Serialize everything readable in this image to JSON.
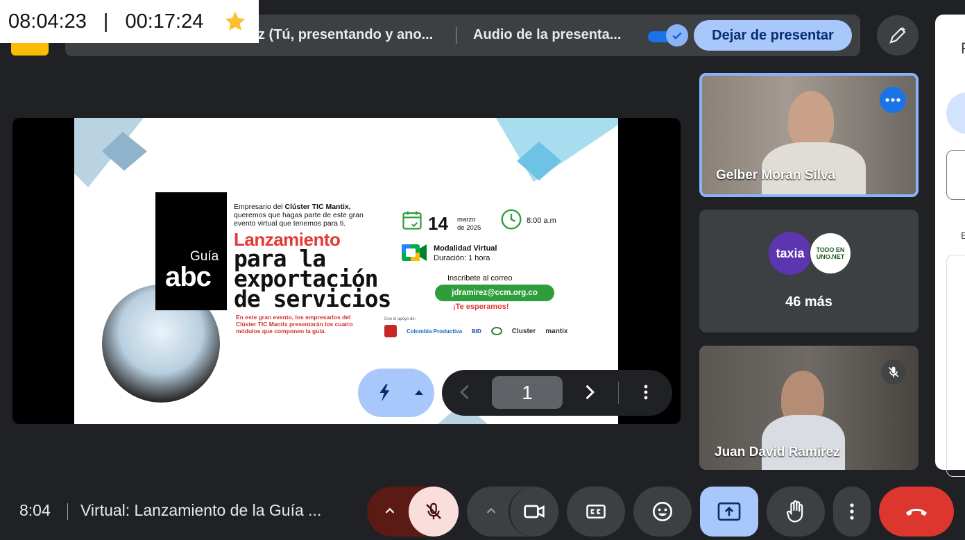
{
  "timer": {
    "clock": "08:04:23",
    "separator": "|",
    "elapsed": "00:17:24"
  },
  "present_bar": {
    "presenter_text": "z (Tú, presentando y ano...",
    "audio_label": "Audio de la presenta...",
    "stop_label": "Dejar de presentar"
  },
  "side_panel": {
    "letter": "F",
    "small": "E"
  },
  "slide": {
    "guia": "Guía",
    "abc": "abc",
    "intro_prefix": "Empresario del ",
    "intro_bold": "Clúster TIC Mantix,",
    "intro_rest": " queremos que hagas parte de este gran evento virtual que tenemos para ti.",
    "lanzamiento": "Lanzamiento",
    "para_la": "para la",
    "exportacion": "exportación",
    "de_servicios": "de servicios",
    "description": "En este gran evento, los empresarios del Clúster TIC Mantix presentarán los cuatro módulos que componen la guía.",
    "apoyo": "Con el apoyo de:",
    "day": "14",
    "month": "marzo",
    "year": "de 2025",
    "time": "8:00 a.m",
    "modalidad": "Modalidad Virtual",
    "duracion": "Duración: 1 hora",
    "inscribete": "Inscribete al correo",
    "email": "jdramirez@ccm.org.co",
    "esperamos": "¡Te esperamos!",
    "logos": [
      "Colombia Productiva",
      "BID",
      "Cluster",
      "mantix"
    ]
  },
  "slide_nav": {
    "page": "1"
  },
  "tiles": {
    "speaker1": "Gelber Moran Silva",
    "avatar1": "taxia",
    "avatar2": "TODO EN UNO.NET",
    "more_count": "46 más",
    "speaker2": "Juan David Ramírez"
  },
  "bottom": {
    "clock": "8:04",
    "meeting_title": "Virtual: Lanzamiento de la Guía ..."
  },
  "colors": {
    "background": "#202124",
    "accent": "#a8c7fa",
    "leave": "#dc362e",
    "mic_off": "#f9dedc"
  }
}
